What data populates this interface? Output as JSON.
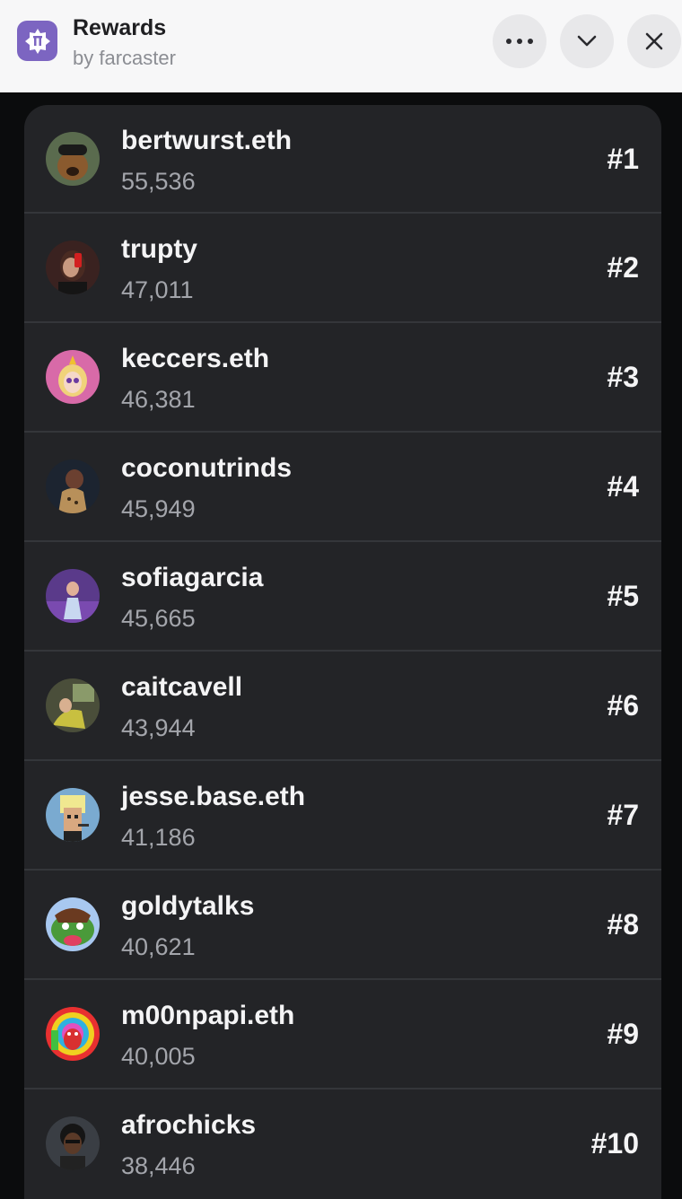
{
  "header": {
    "title": "Rewards",
    "subtitle": "by farcaster",
    "more_icon": "more-horizontal-icon",
    "collapse_icon": "chevron-down-icon",
    "close_icon": "close-icon"
  },
  "colors": {
    "brand": "#7c65c1",
    "header_bg": "#f7f7f8",
    "list_bg": "#232427",
    "divider": "#34363a"
  },
  "leaderboard": [
    {
      "name": "bertwurst.eth",
      "score": "55,536",
      "rank": "#1"
    },
    {
      "name": "trupty",
      "score": "47,011",
      "rank": "#2"
    },
    {
      "name": "keccers.eth",
      "score": "46,381",
      "rank": "#3"
    },
    {
      "name": "coconutrinds",
      "score": "45,949",
      "rank": "#4"
    },
    {
      "name": "sofiagarcia",
      "score": "45,665",
      "rank": "#5"
    },
    {
      "name": "caitcavell",
      "score": "43,944",
      "rank": "#6"
    },
    {
      "name": "jesse.base.eth",
      "score": "41,186",
      "rank": "#7"
    },
    {
      "name": "goldytalks",
      "score": "40,621",
      "rank": "#8"
    },
    {
      "name": "m00npapi.eth",
      "score": "40,005",
      "rank": "#9"
    },
    {
      "name": "afrochicks",
      "score": "38,446",
      "rank": "#10"
    }
  ]
}
